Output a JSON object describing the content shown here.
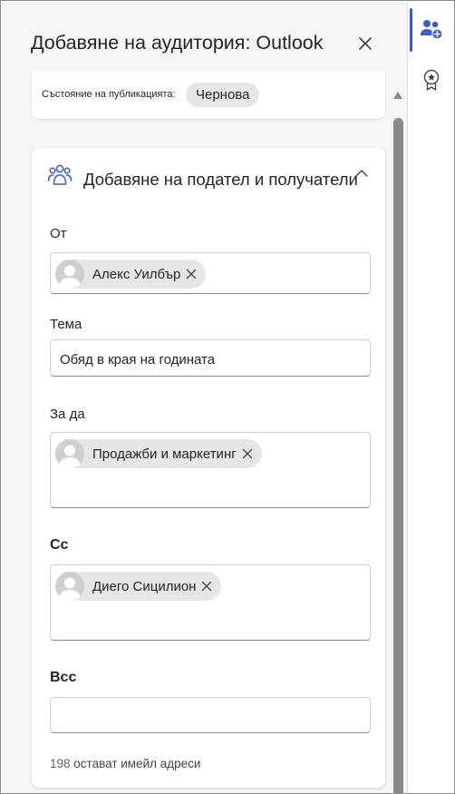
{
  "header": {
    "title": "Добавяне на аудитория: Outlook",
    "close_icon": "close-icon"
  },
  "status": {
    "label": "Състояние на публикацията:",
    "value": "Чернова"
  },
  "section": {
    "icon": "people-group-icon",
    "heading": "Добавяне на подател и получатели"
  },
  "fields": {
    "from": {
      "label": "От",
      "recipient": "Алекс Уилбър"
    },
    "subject": {
      "label": "Тема",
      "value": "Обяд в края на годината"
    },
    "to": {
      "label": "За да",
      "recipient": "Продажби и маркетинг"
    },
    "cc": {
      "label": "Cc",
      "recipient": "Диего Сицилион"
    },
    "bcc": {
      "label": "Bcc",
      "value": ""
    }
  },
  "remaining": {
    "count": "198",
    "text": "остават имейл адреси"
  },
  "rail": {
    "items": [
      {
        "icon": "people-add-icon",
        "active": true
      },
      {
        "icon": "ribbon-star-icon",
        "active": false
      }
    ]
  },
  "colors": {
    "accent": "#3b5bd6",
    "pane_bg": "#f5f5f5",
    "pill_bg": "#e6e6e6",
    "scrollbar": "#8a8a8a"
  }
}
